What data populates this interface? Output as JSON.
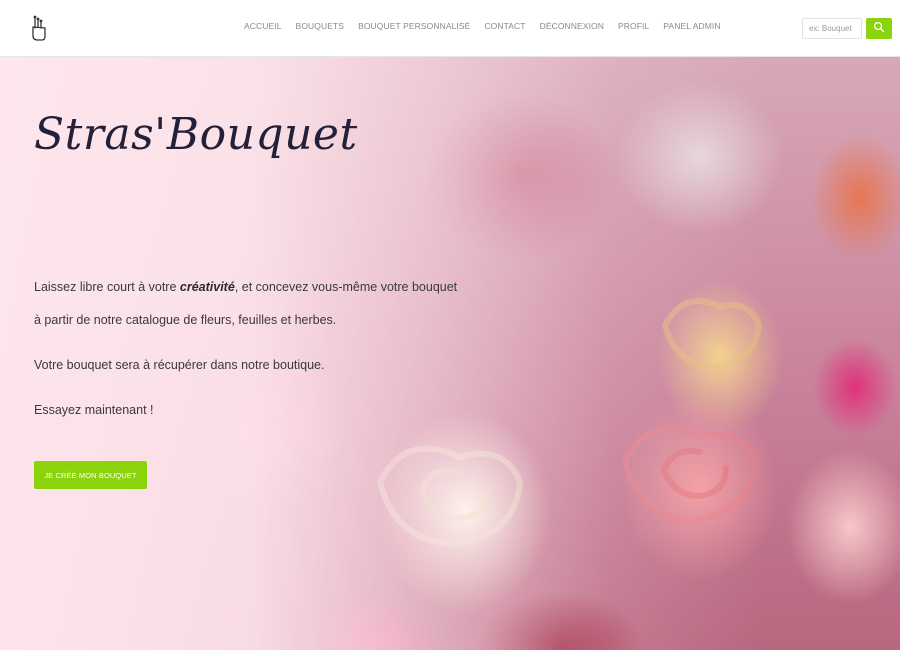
{
  "nav": {
    "logo_icon": "hand-bouquet-icon",
    "items": [
      "ACCUEIL",
      "BOUQUETS",
      "BOUQUET PERSONNALISÉ",
      "CONTACT",
      "DÉCONNEXION",
      "PROFIL",
      "PANEL ADMIN"
    ],
    "search_placeholder": "ex: Bouquet",
    "search_icon": "search-icon"
  },
  "hero": {
    "title": "Stras'Bouquet",
    "line1_before": "Laissez libre court à votre ",
    "line1_emphasis": "créativité",
    "line1_after": ", et concevez vous-même votre bouquet",
    "line2": "à partir de notre catalogue de fleurs, feuilles et herbes.",
    "line3": "Votre bouquet sera à récupérer dans notre boutique.",
    "line4": "Essayez maintenant !",
    "cta_label": "JE CRÉE MON BOUQUET"
  },
  "colors": {
    "accent": "#8bd40b",
    "title": "#23203a"
  }
}
